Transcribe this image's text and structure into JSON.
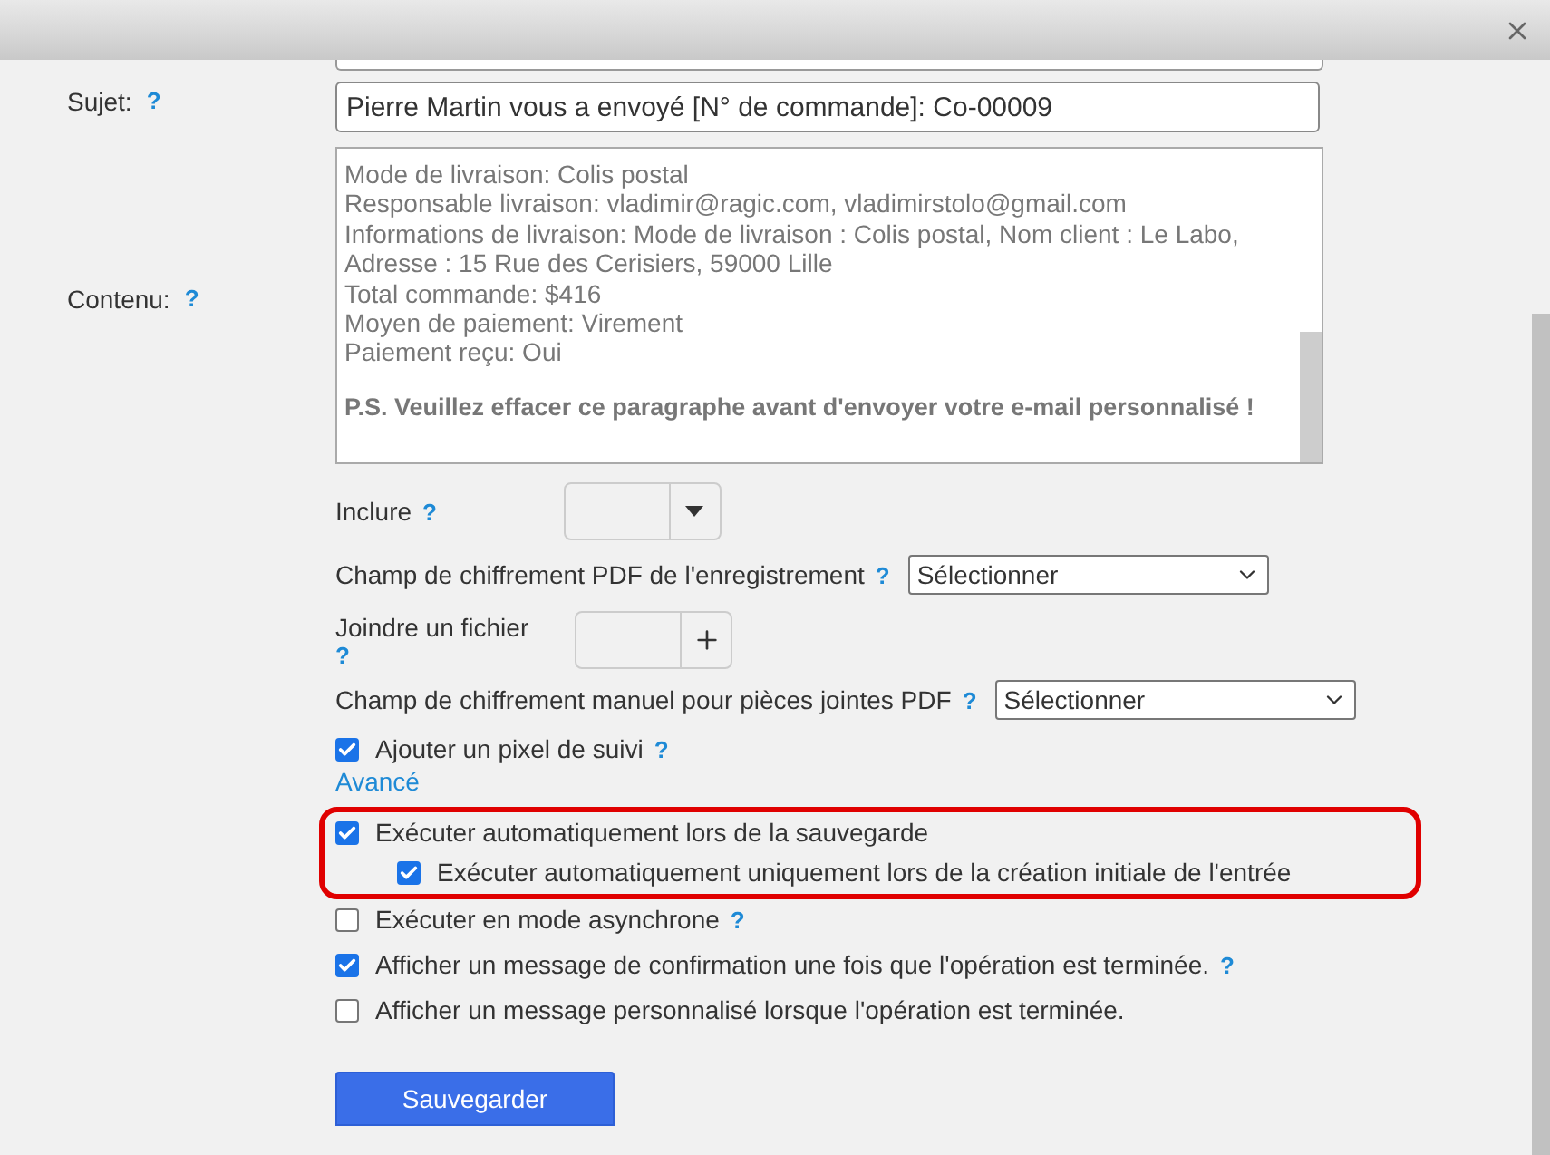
{
  "subject": {
    "label": "Sujet:",
    "help": "?",
    "value": "Pierre Martin vous a envoyé [N° de commande]: Co-00009"
  },
  "content": {
    "label": "Contenu:",
    "help": "?",
    "lines": [
      "Mode de livraison: Colis postal",
      "Responsable livraison: vladimir@ragic.com, vladimirstolo@gmail.com",
      "Informations de livraison: Mode de livraison : Colis postal, Nom client : Le Labo, Adresse : 15 Rue des Cerisiers, 59000 Lille",
      "Total commande: $416",
      "Moyen de paiement: Virement",
      "Paiement reçu: Oui"
    ],
    "note": "P.S. Veuillez effacer ce paragraphe avant d'envoyer votre e-mail personnalisé !"
  },
  "include": {
    "label": "Inclure",
    "help": "?"
  },
  "pdf_field": {
    "label": "Champ de chiffrement PDF de l'enregistrement",
    "help": "?",
    "value": "Sélectionner"
  },
  "attach": {
    "label": "Joindre un fichier",
    "help": "?"
  },
  "manual_pdf": {
    "label": "Champ de chiffrement manuel pour pièces jointes PDF",
    "help": "?",
    "value": "Sélectionner"
  },
  "tracking": {
    "label": "Ajouter un pixel de suivi",
    "help": "?",
    "checked": true
  },
  "advanced_link": "Avancé",
  "highlighted_options": [
    {
      "label": "Exécuter automatiquement lors de la sauvegarde",
      "checked": true,
      "children": [
        {
          "label": "Exécuter automatiquement uniquement lors de la création initiale de l'entrée",
          "checked": true
        }
      ]
    }
  ],
  "options": [
    {
      "label": "Exécuter en mode asynchrone",
      "help": "?",
      "checked": false
    },
    {
      "label": "Afficher un message de confirmation une fois que l'opération est terminée.",
      "help": "?",
      "checked": true
    },
    {
      "label": "Afficher un message personnalisé lorsque l'opération est terminée.",
      "checked": false
    }
  ],
  "save_button": "Sauvegarder"
}
